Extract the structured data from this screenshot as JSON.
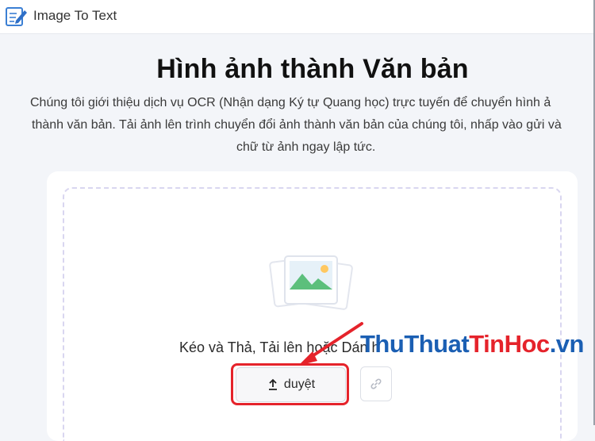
{
  "window": {
    "title": "Image To Text",
    "app_icon": "notepad-pencil-icon"
  },
  "hero": {
    "title": "Hình ảnh thành Văn bản",
    "description_lines": [
      "Chúng tôi giới thiệu dịch vụ OCR (Nhận dạng Ký tự Quang học) trực tuyến để chuyển hình ả",
      "thành văn bản. Tải ảnh lên trình chuyển đổi ảnh thành văn bản của chúng tôi, nhấp vào gửi và",
      "chữ từ ảnh ngay lập tức."
    ]
  },
  "upload": {
    "drag_text": "Kéo và Thả, Tải lên hoặc Dán h",
    "browse_label": "duyệt",
    "browse_icon": "upload-icon",
    "link_icon": "link-icon",
    "placeholder_icon": "image-gallery-icon"
  },
  "watermark": {
    "part1": "Thu",
    "part2": "Thuat",
    "part3": "TinHoc",
    "part4": ".vn"
  },
  "colors": {
    "highlight": "#e5232b",
    "accent": "#1b5fb3"
  }
}
